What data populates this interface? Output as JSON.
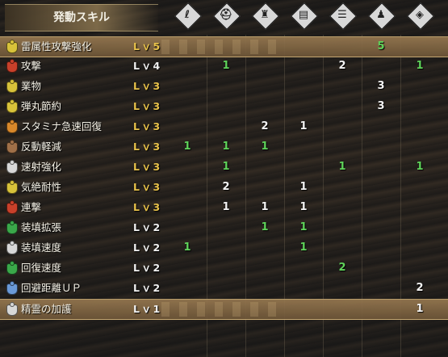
{
  "header": {
    "title": "発動スキル",
    "equipment_slots": [
      {
        "icon": "weapon-slot-icon",
        "glyph": "ℓ"
      },
      {
        "icon": "head-armor-icon",
        "glyph": "⛑"
      },
      {
        "icon": "chest-armor-icon",
        "glyph": "♜"
      },
      {
        "icon": "arm-armor-icon",
        "glyph": "▤"
      },
      {
        "icon": "waist-armor-icon",
        "glyph": "☰"
      },
      {
        "icon": "leg-armor-icon",
        "glyph": "♟"
      },
      {
        "icon": "charm-icon",
        "glyph": "◈"
      }
    ]
  },
  "colors": {
    "level_max": "#e8c24a",
    "level_normal": "#f0f0f0",
    "value_green": "#5fd35a",
    "value_white": "#f4f4f4"
  },
  "skills": [
    {
      "name": "雷属性攻撃強化",
      "level": "Lｖ5",
      "maxed": true,
      "highlight": true,
      "icon": "skill-yellow-icon",
      "icon_color": "#d8c23a",
      "values": [
        "",
        "",
        "",
        "",
        "",
        "5",
        ""
      ],
      "value_colors": [
        "",
        "",
        "",
        "",
        "",
        "green",
        ""
      ]
    },
    {
      "name": "攻撃",
      "level": "Lｖ4",
      "maxed": false,
      "highlight": false,
      "icon": "skill-red-icon",
      "icon_color": "#c8402a",
      "values": [
        "",
        "1",
        "",
        "",
        "2",
        "",
        "1"
      ],
      "value_colors": [
        "",
        "green",
        "",
        "",
        "white",
        "",
        "green"
      ]
    },
    {
      "name": "業物",
      "level": "Lｖ3",
      "maxed": true,
      "highlight": false,
      "icon": "skill-yellow-icon",
      "icon_color": "#d8c23a",
      "values": [
        "",
        "",
        "",
        "",
        "",
        "3",
        ""
      ],
      "value_colors": [
        "",
        "",
        "",
        "",
        "",
        "white",
        ""
      ]
    },
    {
      "name": "弾丸節約",
      "level": "Lｖ3",
      "maxed": true,
      "highlight": false,
      "icon": "skill-yellow-icon",
      "icon_color": "#d8c23a",
      "values": [
        "",
        "",
        "",
        "",
        "",
        "3",
        ""
      ],
      "value_colors": [
        "",
        "",
        "",
        "",
        "",
        "white",
        ""
      ]
    },
    {
      "name": "スタミナ急速回復",
      "level": "Lｖ3",
      "maxed": true,
      "highlight": false,
      "icon": "skill-orange-icon",
      "icon_color": "#d8882a",
      "values": [
        "",
        "",
        "2",
        "1",
        "",
        "",
        ""
      ],
      "value_colors": [
        "",
        "",
        "white",
        "white",
        "",
        "",
        ""
      ]
    },
    {
      "name": "反動軽減",
      "level": "Lｖ3",
      "maxed": true,
      "highlight": false,
      "icon": "skill-brown-icon",
      "icon_color": "#a07048",
      "values": [
        "1",
        "1",
        "1",
        "",
        "",
        "",
        ""
      ],
      "value_colors": [
        "green",
        "green",
        "green",
        "",
        "",
        "",
        ""
      ]
    },
    {
      "name": "速射強化",
      "level": "Lｖ3",
      "maxed": true,
      "highlight": false,
      "icon": "skill-white-icon",
      "icon_color": "#d8d8d8",
      "values": [
        "",
        "1",
        "",
        "",
        "1",
        "",
        "1"
      ],
      "value_colors": [
        "",
        "green",
        "",
        "",
        "green",
        "",
        "green"
      ]
    },
    {
      "name": "気絶耐性",
      "level": "Lｖ3",
      "maxed": true,
      "highlight": false,
      "icon": "skill-yellow-icon",
      "icon_color": "#d8c23a",
      "values": [
        "",
        "2",
        "",
        "1",
        "",
        "",
        ""
      ],
      "value_colors": [
        "",
        "white",
        "",
        "white",
        "",
        "",
        ""
      ]
    },
    {
      "name": "連撃",
      "level": "Lｖ3",
      "maxed": true,
      "highlight": false,
      "icon": "skill-red-icon",
      "icon_color": "#c8402a",
      "values": [
        "",
        "1",
        "1",
        "1",
        "",
        "",
        ""
      ],
      "value_colors": [
        "",
        "white",
        "white",
        "white",
        "",
        "",
        ""
      ]
    },
    {
      "name": "装填拡張",
      "level": "Lｖ2",
      "maxed": false,
      "highlight": false,
      "icon": "skill-green-icon",
      "icon_color": "#3aa84a",
      "values": [
        "",
        "",
        "1",
        "1",
        "",
        "",
        ""
      ],
      "value_colors": [
        "",
        "",
        "green",
        "green",
        "",
        "",
        ""
      ]
    },
    {
      "name": "装填速度",
      "level": "Lｖ2",
      "maxed": false,
      "highlight": false,
      "icon": "skill-white-icon",
      "icon_color": "#d8d8d8",
      "values": [
        "1",
        "",
        "",
        "1",
        "",
        "",
        ""
      ],
      "value_colors": [
        "green",
        "",
        "",
        "green",
        "",
        "",
        ""
      ]
    },
    {
      "name": "回復速度",
      "level": "Lｖ2",
      "maxed": false,
      "highlight": false,
      "icon": "skill-green-icon",
      "icon_color": "#3aa84a",
      "values": [
        "",
        "",
        "",
        "",
        "2",
        "",
        ""
      ],
      "value_colors": [
        "",
        "",
        "",
        "",
        "green",
        "",
        ""
      ]
    },
    {
      "name": "回避距離ＵＰ",
      "level": "Lｖ2",
      "maxed": false,
      "highlight": false,
      "icon": "skill-blue-icon",
      "icon_color": "#6a9ad8",
      "values": [
        "",
        "",
        "",
        "",
        "",
        "",
        "2"
      ],
      "value_colors": [
        "",
        "",
        "",
        "",
        "",
        "",
        "white"
      ]
    },
    {
      "name": "精霊の加護",
      "level": "Lｖ1",
      "maxed": false,
      "highlight": true,
      "icon": "skill-white-icon",
      "icon_color": "#d8d8d8",
      "values": [
        "",
        "",
        "",
        "",
        "",
        "",
        "1"
      ],
      "value_colors": [
        "",
        "",
        "",
        "",
        "",
        "",
        "white"
      ]
    }
  ]
}
